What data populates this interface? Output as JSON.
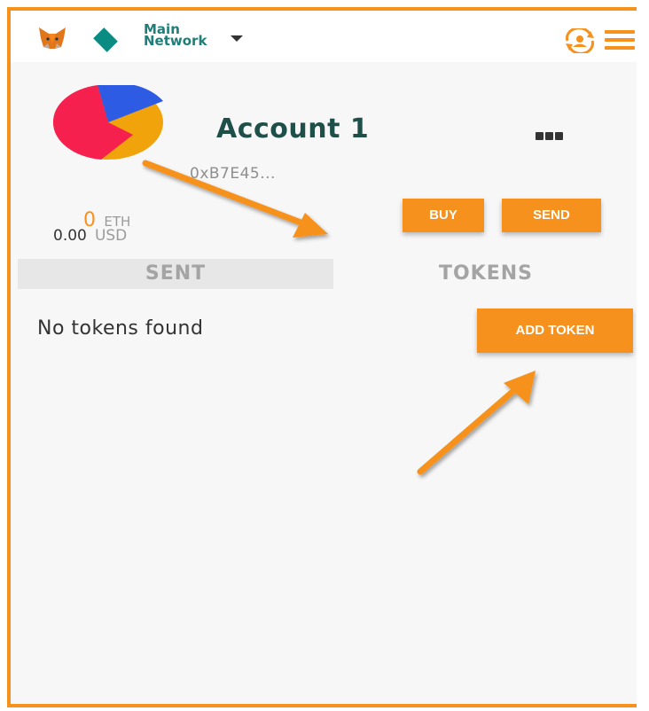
{
  "header": {
    "network_line1": "Main",
    "network_line2": "Network"
  },
  "account": {
    "name": "Account 1",
    "address": "0xB7E45...",
    "eth_value": "0",
    "eth_unit": "ETH",
    "usd_value": "0.00",
    "usd_unit": "USD"
  },
  "actions": {
    "buy_label": "BUY",
    "send_label": "SEND"
  },
  "tabs": [
    {
      "label": "SENT",
      "active": false
    },
    {
      "label": "TOKENS",
      "active": true
    }
  ],
  "tokens": {
    "empty_message": "No tokens found",
    "add_token_label": "ADD TOKEN"
  },
  "colors": {
    "accent": "#f6911e",
    "network": "#0a8c83",
    "account_name": "#1f4f49"
  },
  "icons": {
    "logo": "metamask-fox-icon",
    "network": "network-diamond-icon",
    "sync": "account-sync-icon",
    "menu": "hamburger-menu-icon"
  }
}
